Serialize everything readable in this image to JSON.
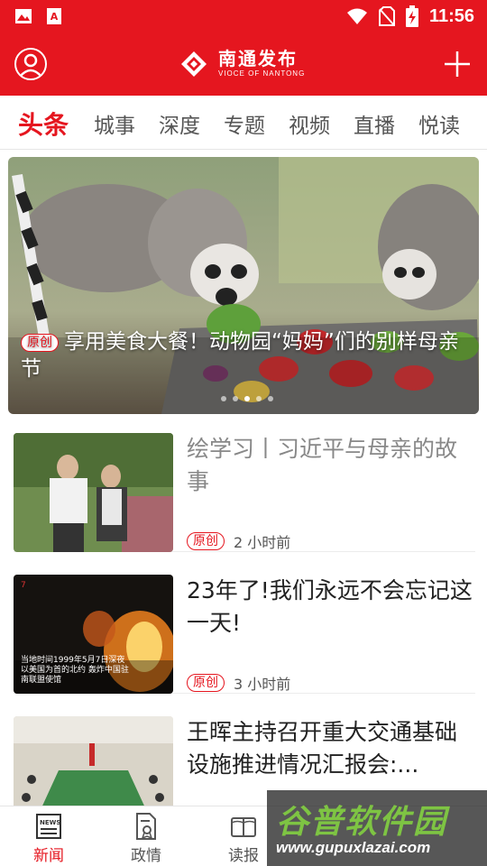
{
  "status_bar": {
    "time": "11:56",
    "icons": [
      "image-icon",
      "font-app-icon",
      "wifi-icon",
      "no-sim-icon",
      "battery-charging-icon"
    ]
  },
  "app_bar": {
    "logo_title": "南通发布",
    "logo_subtitle": "VIOCE OF NANTONG",
    "left_icon": "user-icon",
    "right_icon": "plus-icon"
  },
  "tabs": [
    {
      "label": "头条",
      "active": true
    },
    {
      "label": "城事"
    },
    {
      "label": "深度"
    },
    {
      "label": "专题"
    },
    {
      "label": "视频"
    },
    {
      "label": "直播"
    },
    {
      "label": "悦读"
    }
  ],
  "hero": {
    "badge": "原创",
    "title": "享用美食大餐！动物园“妈妈”们的别样母亲节",
    "slide_count": 5,
    "active_slide": 3
  },
  "news": [
    {
      "title": "绘学习丨习近平与母亲的故事",
      "badge": "原创",
      "time": "2 小时前",
      "read": true,
      "thumb_caption": ""
    },
    {
      "title": "23年了!我们永远不会忘记这一天!",
      "badge": "原创",
      "time": "3 小时前",
      "read": false,
      "thumb_caption": "当地时间1999年5月7日深夜 以美国为首的北约 轰炸中国驻南联盟使馆"
    },
    {
      "title": "王晖主持召开重大交通基础设施推进情况汇报会:...",
      "badge": "",
      "time": "",
      "read": false,
      "thumb_caption": ""
    }
  ],
  "bottom_nav": [
    {
      "label": "新闻",
      "icon": "news-icon",
      "active": true
    },
    {
      "label": "政情",
      "icon": "document-award-icon"
    },
    {
      "label": "读报",
      "icon": "newspaper-icon"
    }
  ],
  "watermark": {
    "title": "谷普软件园",
    "url": "www.gupuxlazai.com"
  },
  "colors": {
    "brand_red": "#e5161f",
    "text": "#222222",
    "read_text": "#888888"
  }
}
